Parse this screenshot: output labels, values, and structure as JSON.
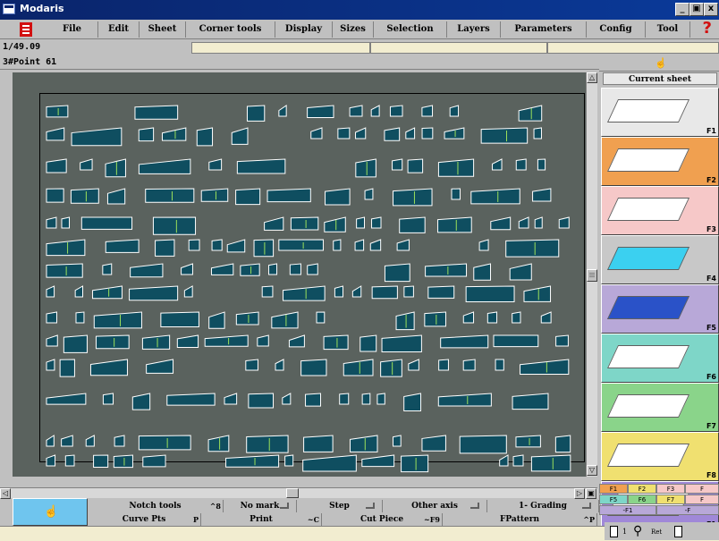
{
  "window": {
    "title": "Modaris",
    "controls": [
      "_",
      "̅",
      "x"
    ]
  },
  "menu": {
    "items": [
      "File",
      "Edit",
      "Sheet",
      "Corner tools",
      "Display",
      "Sizes",
      "Selection",
      "Layers",
      "Parameters",
      "Config",
      "Tool"
    ],
    "help": "?"
  },
  "status": {
    "scale": "1/49.09",
    "point": "3#Point 61"
  },
  "panel": {
    "title": "Current sheet",
    "tools": [
      {
        "key": "F1",
        "color": "#e8e8e8"
      },
      {
        "key": "F2",
        "color": "#f0a050"
      },
      {
        "key": "F3",
        "color": "#f6c8c8"
      },
      {
        "key": "F4",
        "color": "#c8c8c8"
      },
      {
        "key": "F5",
        "color": "#b8a8d8"
      },
      {
        "key": "F6",
        "color": "#7ed6c8"
      },
      {
        "key": "F7",
        "color": "#8ad48a"
      },
      {
        "key": "F8",
        "color": "#f0e070"
      },
      {
        "key": "-F1",
        "color": "#a088d8"
      }
    ],
    "keys_row1": [
      "F1",
      "F2",
      "F3",
      "F"
    ],
    "keys_row2": [
      "F5",
      "F6",
      "F7",
      "F"
    ],
    "keys_row3": [
      "-F1",
      "-F"
    ]
  },
  "bottom": {
    "row1": [
      {
        "label": "Notch tools",
        "hot": "^8"
      },
      {
        "label": "No mark",
        "hot": ""
      },
      {
        "label": "Step",
        "hot": ""
      },
      {
        "label": "Other axis",
        "hot": ""
      },
      {
        "label": "1- Grading",
        "hot": ""
      }
    ],
    "row2": [
      {
        "label": "Curve Pts",
        "hot": "P"
      },
      {
        "label": "Print",
        "hot": "~C"
      },
      {
        "label": "Cut Piece",
        "hot": "~F9"
      },
      {
        "label": "FPattern",
        "hot": "^P"
      }
    ],
    "zoom_label": "Ret",
    "zoom_small": "1"
  },
  "colors": {
    "piece_fill": "#0f4e60",
    "piece_stroke": "#ffffff",
    "workspace": "#5a625e",
    "accent_line": "#9be05a"
  }
}
